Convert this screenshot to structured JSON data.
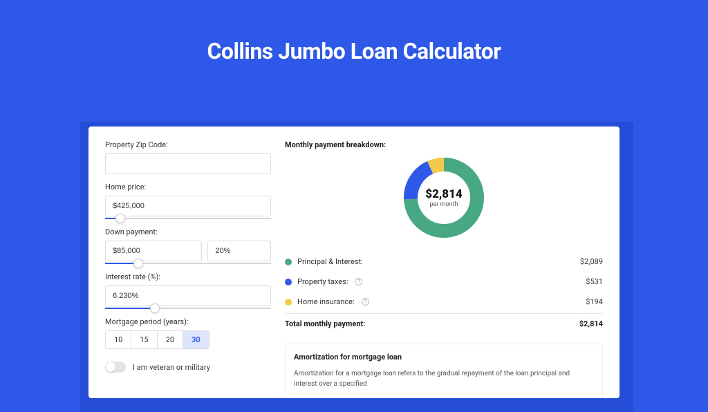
{
  "page": {
    "title": "Collins Jumbo Loan Calculator"
  },
  "form": {
    "zip": {
      "label": "Property Zip Code:",
      "value": ""
    },
    "home_price": {
      "label": "Home price:",
      "value": "$425,000",
      "slider_pct": 9
    },
    "down_payment": {
      "label": "Down payment:",
      "amount": "$85,000",
      "percent": "20%",
      "slider_pct": 20
    },
    "interest_rate": {
      "label": "Interest rate (%):",
      "value": "6.230%",
      "slider_pct": 30
    },
    "mortgage_period": {
      "label": "Mortgage period (years):",
      "options": [
        "10",
        "15",
        "20",
        "30"
      ],
      "active_index": 3
    },
    "veteran": {
      "label": "I am veteran or military",
      "checked": false
    }
  },
  "breakdown": {
    "header": "Monthly payment breakdown:",
    "center_amount": "$2,814",
    "center_sub": "per month",
    "items": [
      {
        "label": "Principal & Interest:",
        "value": "$2,089",
        "color": "#49a884",
        "has_info": false
      },
      {
        "label": "Property taxes:",
        "value": "$531",
        "color": "#2e58e8",
        "has_info": true
      },
      {
        "label": "Home insurance:",
        "value": "$194",
        "color": "#f2c94c",
        "has_info": true
      }
    ],
    "total": {
      "label": "Total monthly payment:",
      "value": "$2,814"
    }
  },
  "chart_data": {
    "type": "pie",
    "title": "Monthly payment breakdown",
    "series": [
      {
        "name": "Principal & Interest",
        "value": 2089,
        "color": "#49a884"
      },
      {
        "name": "Property taxes",
        "value": 531,
        "color": "#2e58e8"
      },
      {
        "name": "Home insurance",
        "value": 194,
        "color": "#f2c94c"
      }
    ],
    "total": 2814
  },
  "amortization": {
    "title": "Amortization for mortgage loan",
    "text": "Amortization for a mortgage loan refers to the gradual repayment of the loan principal and interest over a specified"
  }
}
